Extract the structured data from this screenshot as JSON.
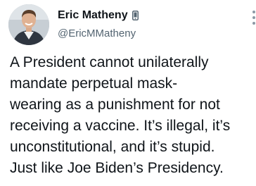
{
  "author": {
    "display_name": "Eric Matheny",
    "handle": "@EricMMatheny",
    "device_icon": "phone-icon"
  },
  "tweet": {
    "lines": [
      "A President cannot unilaterally",
      "mandate perpetual mask-",
      "wearing as a punishment for not",
      "receiving a vaccine. It’s illegal, it’s",
      "unconstitutional, and it’s stupid.",
      "Just like Joe Biden’s Presidency."
    ]
  },
  "colors": {
    "text_primary": "#0f1419",
    "text_secondary": "#536471",
    "background": "#ffffff"
  }
}
